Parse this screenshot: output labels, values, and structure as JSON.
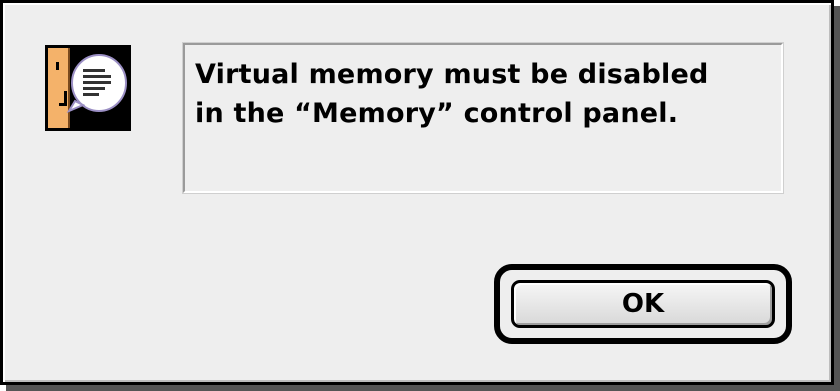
{
  "dialog": {
    "type": "alert",
    "icon": "note-alert-icon",
    "message": "Virtual memory must be disabled\nin the “Memory” control panel.",
    "default_button_label": "OK"
  },
  "colors": {
    "dialog_background": "#eeeeee",
    "border": "#000000",
    "icon_face": "#f4b26a",
    "speech_bubble": "#ffffff"
  }
}
